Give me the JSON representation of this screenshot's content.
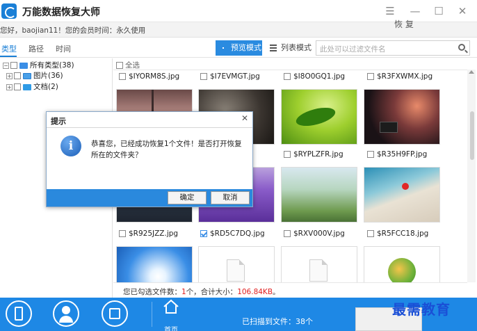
{
  "window": {
    "title": "万能数据恢复大师",
    "controls": {
      "menu": "☰",
      "minimize": "—",
      "maximize": "☐",
      "close": "✕"
    }
  },
  "user_bar": {
    "text": "您好，baojian11！您的会员时间：永久使用"
  },
  "toolbar": {
    "tabs": [
      {
        "label": "类型",
        "active": true
      },
      {
        "label": "路径",
        "active": false
      },
      {
        "label": "时间",
        "active": false
      }
    ],
    "preview_mode_label": "预览模式",
    "list_mode_label": "列表模式",
    "search_placeholder": "此处可以过滤文件名"
  },
  "tree": {
    "items": [
      {
        "label": "所有类型(38)",
        "icon": "computer-icon"
      },
      {
        "label": "图片(36)",
        "icon": "picture-folder-icon"
      },
      {
        "label": "文档(2)",
        "icon": "document-folder-icon"
      }
    ]
  },
  "grid": {
    "select_all_label": "全选",
    "rows": [
      {
        "files": [
          "$IYORM8S.jpg",
          "$I7EVMGT.jpg",
          "$I8O0GQ1.jpg",
          "$R3FXWMX.jpg"
        ]
      },
      {
        "files": [
          "",
          "",
          "$RYPLZFR.jpg",
          "$R35H9FP.jpg"
        ]
      },
      {
        "files": [
          "$R925JZZ.jpg",
          "$RD5C7DQ.jpg",
          "$RXV000V.jpg",
          "$R5FCC18.jpg"
        ]
      }
    ],
    "checked_file": "$RD5C7DQ.jpg"
  },
  "status": {
    "prefix": "您已勾选文件数：",
    "count": "1",
    "middle": "个，合计大小：",
    "size": "106.84KB",
    "suffix": "。"
  },
  "bottom": {
    "home_label": "首页",
    "scan_text": "已扫描到文件：38个",
    "recover_label": "恢 复"
  },
  "watermark": "最需教育",
  "dialog": {
    "title": "提示",
    "close": "✕",
    "message": "恭喜您，已经成功恢复1个文件！是否打开恢复所在的文件夹？",
    "ok_label": "确定",
    "cancel_label": "取消"
  },
  "colors": {
    "accent": "#1e88e5",
    "highlight": "#e02020"
  }
}
